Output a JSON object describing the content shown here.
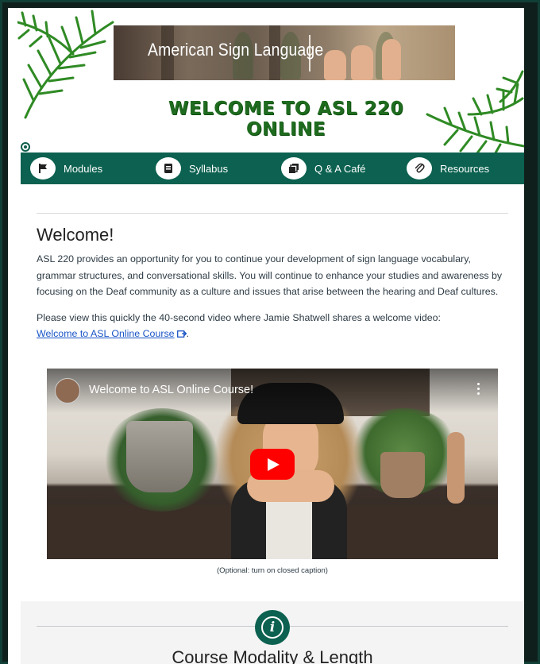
{
  "banner": {
    "image_title": "American Sign Language",
    "welcome_heading": "WELCOME TO ASL 220 ONLINE"
  },
  "nav": {
    "items": [
      {
        "label": "Modules",
        "icon": "flag-icon"
      },
      {
        "label": "Syllabus",
        "icon": "syllabus-icon"
      },
      {
        "label": "Q & A Café",
        "icon": "forum-icon"
      },
      {
        "label": "Resources",
        "icon": "paperclip-icon"
      }
    ]
  },
  "content": {
    "heading": "Welcome!",
    "intro": "ASL 220 provides an opportunity for you to continue your development of sign language vocabulary, grammar structures, and conversational skills. You will continue to enhance your studies and awareness by focusing on the Deaf community as a culture and issues that arise between the hearing and Deaf cultures.",
    "video_prompt": "Please view this quickly the 40-second video where Jamie Shatwell shares a welcome video:",
    "video_link": "Welcome to ASL Online Course",
    "video_link_suffix": "."
  },
  "video": {
    "title": "Welcome to ASL Online Course!",
    "caption": "(Optional: turn on closed caption)"
  },
  "modality": {
    "heading": "Course Modality & Length",
    "icon": "info-icon"
  },
  "colors": {
    "brand_green": "#0c6150",
    "banner_text": "#1f6b1f",
    "link": "#1a55c6",
    "play_red": "#ff0000"
  }
}
